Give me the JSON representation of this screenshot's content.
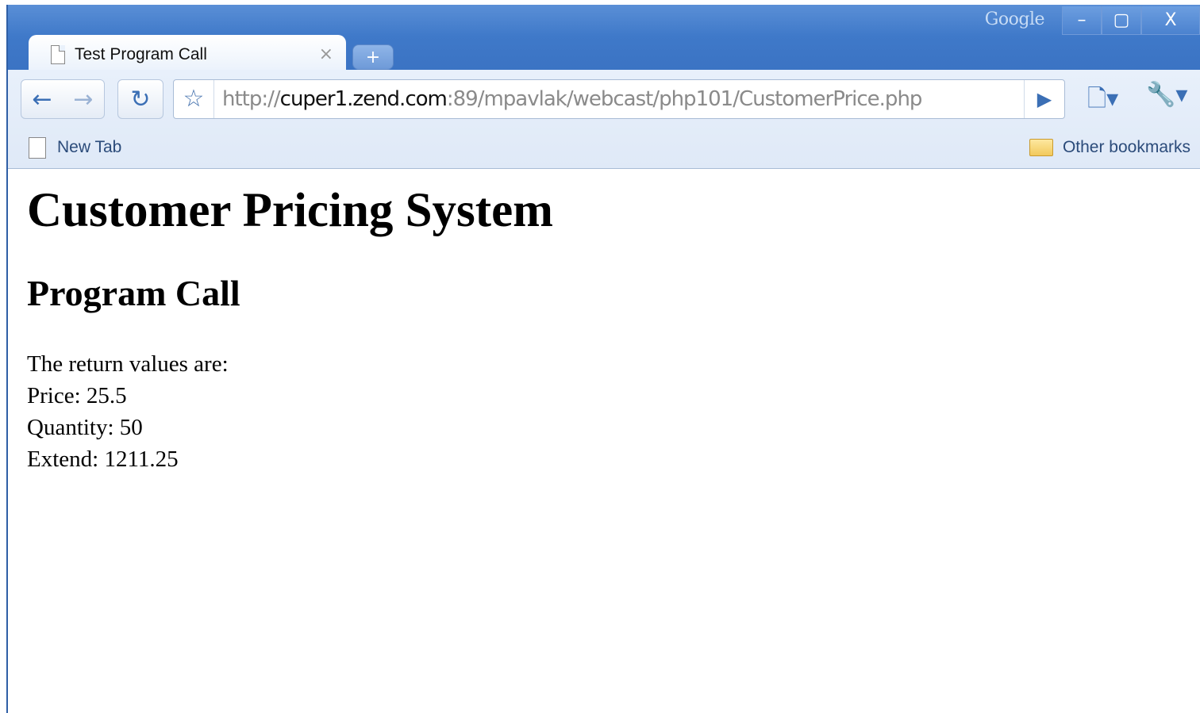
{
  "browser": {
    "brand": "Google",
    "window_controls": {
      "minimize": "–",
      "maximize": "▢",
      "close": "X"
    },
    "tab": {
      "title": "Test Program Call",
      "close": "×"
    },
    "new_tab_symbol": "+",
    "nav": {
      "back": "←",
      "forward": "→",
      "reload": "↻"
    },
    "omnibox": {
      "scheme": "http://",
      "host": "cuper1.zend.com",
      "rest": ":89/mpavlak/webcast/php101/CustomerPrice.php",
      "go": "▶"
    },
    "bookmarks": {
      "new_tab": "New Tab",
      "other": "Other bookmarks"
    }
  },
  "page": {
    "title": "Customer Pricing System",
    "subtitle": "Program Call",
    "lines": [
      "The return values are:",
      "Price: 25.5",
      "Quantity: 50",
      "Extend: 1211.25"
    ]
  }
}
